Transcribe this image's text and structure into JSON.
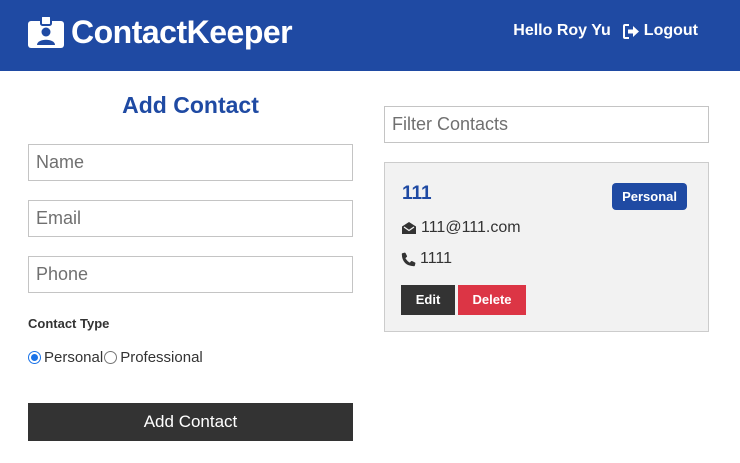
{
  "navbar": {
    "brand": "ContactKeeper",
    "greeting": "Hello Roy Yu",
    "logout_label": "Logout",
    "background": "#1f4aa3"
  },
  "contact_form": {
    "title": "Add Contact",
    "name_placeholder": "Name",
    "email_placeholder": "Email",
    "phone_placeholder": "Phone",
    "name_value": "",
    "email_value": "",
    "phone_value": "",
    "type_label": "Contact Type",
    "type_options": [
      "Personal",
      "Professional"
    ],
    "selected_type": "Personal",
    "submit_label": "Add Contact"
  },
  "filter": {
    "placeholder": "Filter Contacts",
    "value": ""
  },
  "contacts": [
    {
      "name": "111",
      "type": "Personal",
      "email": "111@111.com",
      "phone": "1111",
      "edit_label": "Edit",
      "delete_label": "Delete"
    }
  ],
  "colors": {
    "primary": "#1f4aa3",
    "dark": "#333333",
    "danger": "#dc3545",
    "card_bg": "#f2f2f2"
  },
  "icons": {
    "brand": "id-badge-icon",
    "logout": "sign-out-icon",
    "email": "envelope-open-icon",
    "phone": "phone-icon"
  }
}
